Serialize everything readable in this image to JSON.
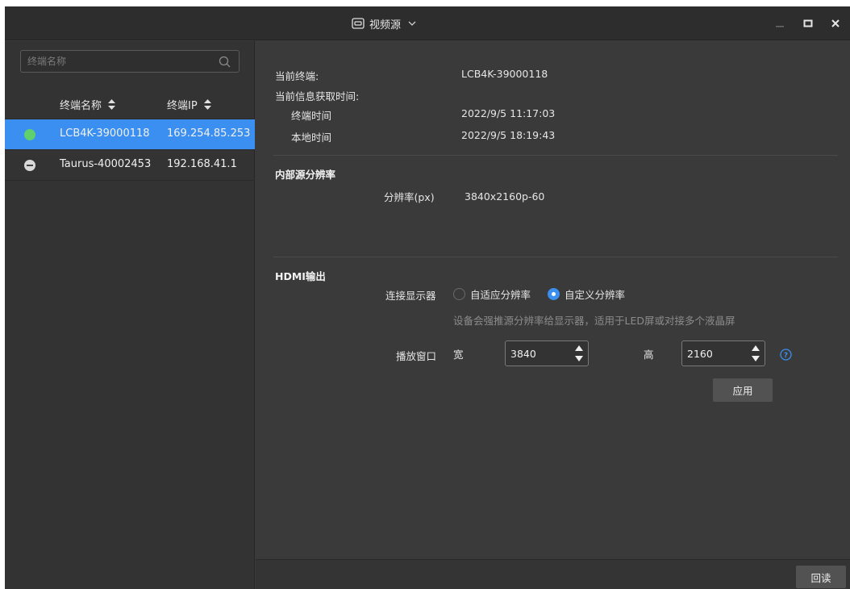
{
  "titlebar": {
    "title": "视频源",
    "icons": [
      "video-source-icon",
      "chevron-down-icon",
      "minimize-icon",
      "maximize-icon",
      "close-icon"
    ]
  },
  "sidebar": {
    "search_placeholder": "终端名称",
    "columns": {
      "name": "终端名称",
      "ip": "终端IP"
    },
    "rows": [
      {
        "name": "LCB4K-39000118",
        "ip": "169.254.85.253",
        "status": "online",
        "selected": true
      },
      {
        "name": "Taurus-40002453",
        "ip": "192.168.41.1",
        "status": "offline",
        "selected": false
      }
    ]
  },
  "info": {
    "current_terminal_label": "当前终端:",
    "current_terminal_value": "LCB4K-39000118",
    "fetch_time_label": "当前信息获取时间:",
    "terminal_time_label": "终端时间",
    "terminal_time_value": "2022/9/5 11:17:03",
    "local_time_label": "本地时间",
    "local_time_value": "2022/9/5 18:19:43"
  },
  "internal": {
    "title": "内部源分辨率",
    "resolution_label": "分辨率(px)",
    "resolution_value": "3840x2160p-60"
  },
  "hdmi": {
    "title": "HDMI输出",
    "connect_label": "连接显示器",
    "option_auto": "自适应分辨率",
    "option_custom": "自定义分辨率",
    "selected_option": "custom",
    "hint": "设备会强推源分辨率给显示器，适用于LED屏或对接多个液晶屏",
    "window_label": "播放窗口",
    "width_label": "宽",
    "width_value": "3840",
    "height_label": "高",
    "height_value": "2160",
    "apply_label": "应用"
  },
  "footer": {
    "readback_label": "回读"
  },
  "colors": {
    "accent": "#3a8ff0",
    "online": "#5fd06b",
    "offline": "#d9d9d9",
    "panel": "#3a3a3a"
  }
}
